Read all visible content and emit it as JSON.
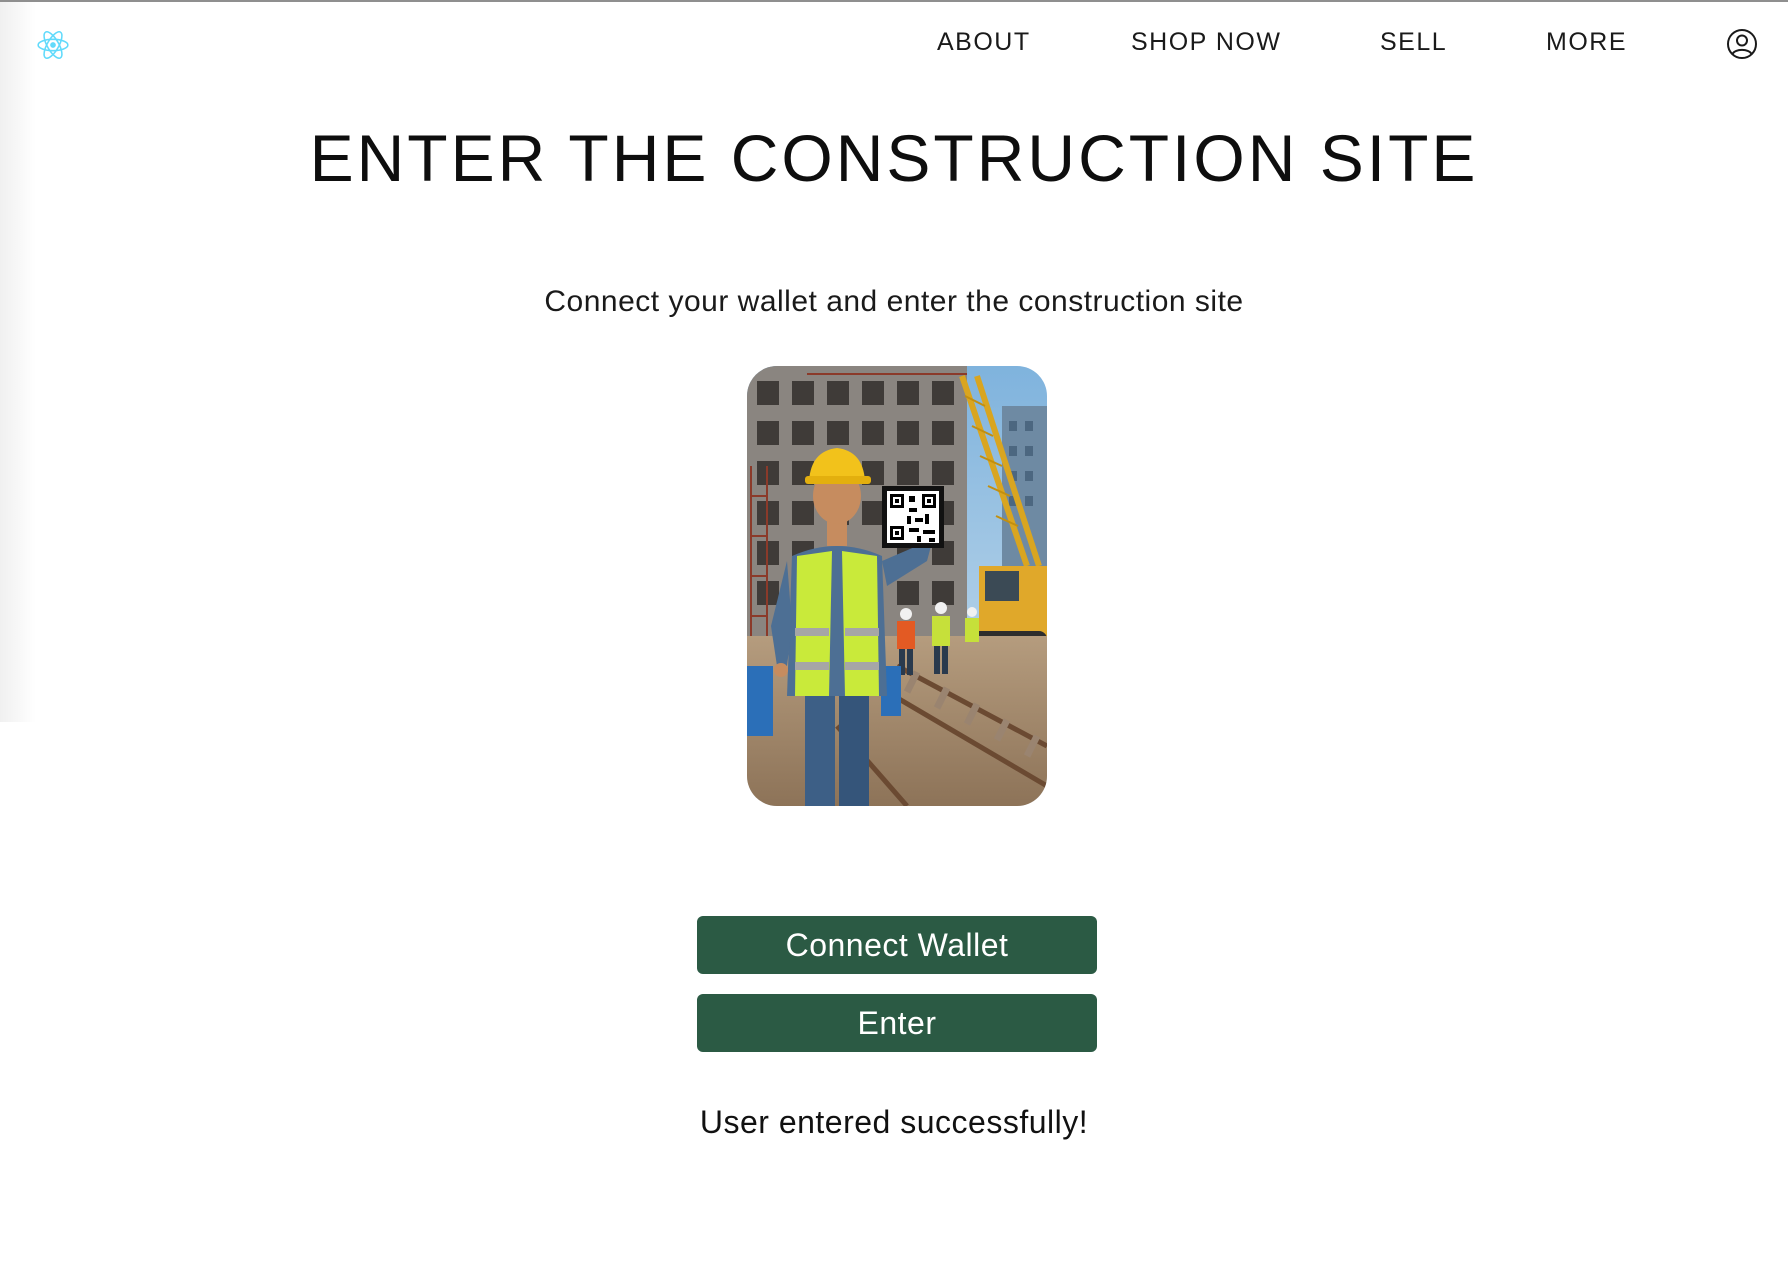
{
  "header": {
    "logo_icon": "react-atom-icon",
    "nav": [
      {
        "label": "ABOUT"
      },
      {
        "label": "SHOP NOW"
      },
      {
        "label": "SELL"
      },
      {
        "label": "MORE"
      }
    ],
    "account_icon": "user-circle-icon"
  },
  "main": {
    "title": "ENTER THE CONSTRUCTION SITE",
    "subtitle": "Connect your wallet and enter the construction site",
    "hero_image": "construction-worker-qr-illustration",
    "connect_button": "Connect Wallet",
    "enter_button": "Enter",
    "status_message": "User entered successfully!"
  },
  "colors": {
    "button_bg": "#2b5a44",
    "button_text": "#ffffff",
    "logo": "#61dafb"
  }
}
